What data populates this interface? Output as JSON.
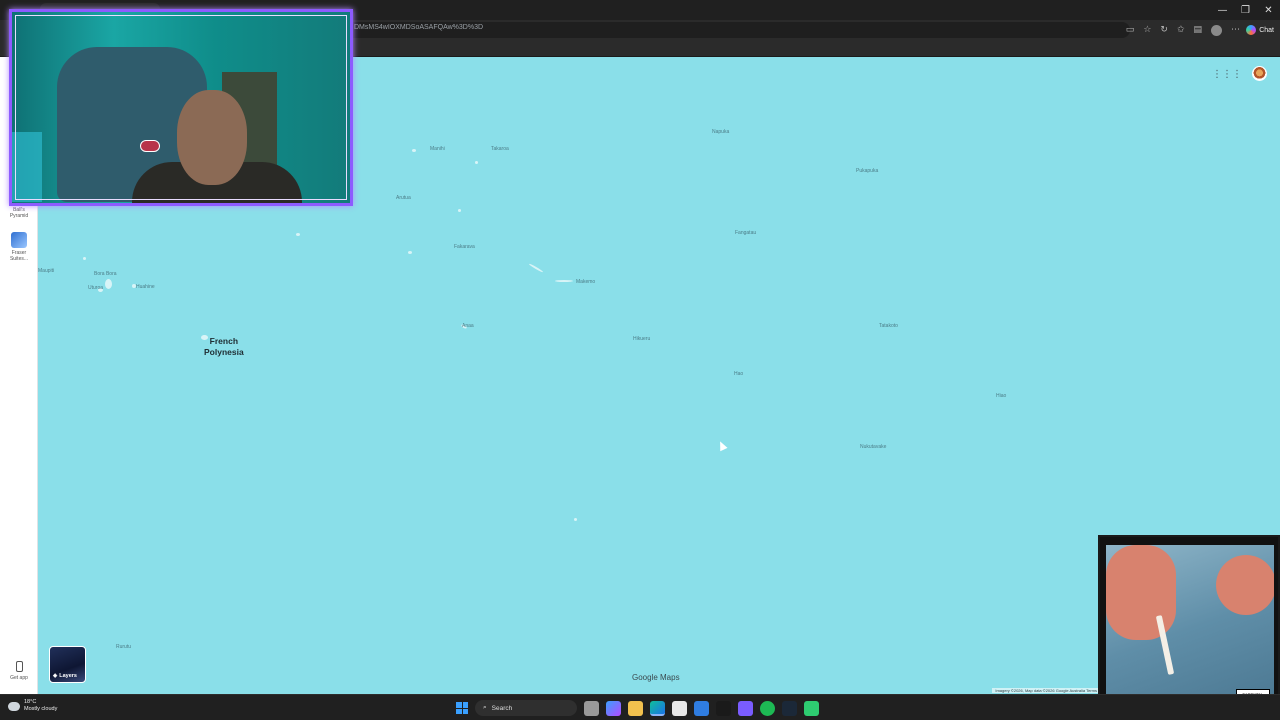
{
  "browser": {
    "url": "DMsMS4wIOXMDSoASAFQAw%3D%3D",
    "window_controls": [
      "—",
      "❐",
      "✕"
    ],
    "chat_label": "Chat"
  },
  "map": {
    "places": [
      {
        "name": "Napuka"
      },
      {
        "name": "Manihi"
      },
      {
        "name": "Takaroa"
      },
      {
        "name": "Pukapuka"
      },
      {
        "name": "Arutua"
      },
      {
        "name": "Fakarava"
      },
      {
        "name": "Fangatau"
      },
      {
        "name": "Maupiti"
      },
      {
        "name": "Bora Bora"
      },
      {
        "name": "Huahine"
      },
      {
        "name": "Uturoa"
      },
      {
        "name": "Makemo"
      },
      {
        "name": "Anaa"
      },
      {
        "name": "Hikueru"
      },
      {
        "name": "Tatakoto"
      },
      {
        "name": "Hao"
      },
      {
        "name": "Hiao"
      },
      {
        "name": "Nukutavake"
      },
      {
        "name": "Rurutu"
      }
    ],
    "region_label_line1": "French",
    "region_label_line2": "Polynesia",
    "brand": "Google Maps",
    "attribution": "Imagery ©2026, Map data ©2026 Google    Australia    Terms",
    "layers_label": "Layers"
  },
  "sidebar": {
    "items": [
      {
        "label_line1": "Ball's",
        "label_line2": "Pyramid"
      },
      {
        "label_line1": "Fraser",
        "label_line2": "Suites..."
      }
    ],
    "get_app_label": "Get app"
  },
  "taskbar": {
    "temperature": "18°C",
    "weather": "Mostly cloudy",
    "search_label": "Search"
  },
  "album": {
    "advisory_line1": "PARENTAL",
    "advisory_line2": "ADVISORY",
    "advisory_line3": "EXPLICIT CONTENT"
  }
}
